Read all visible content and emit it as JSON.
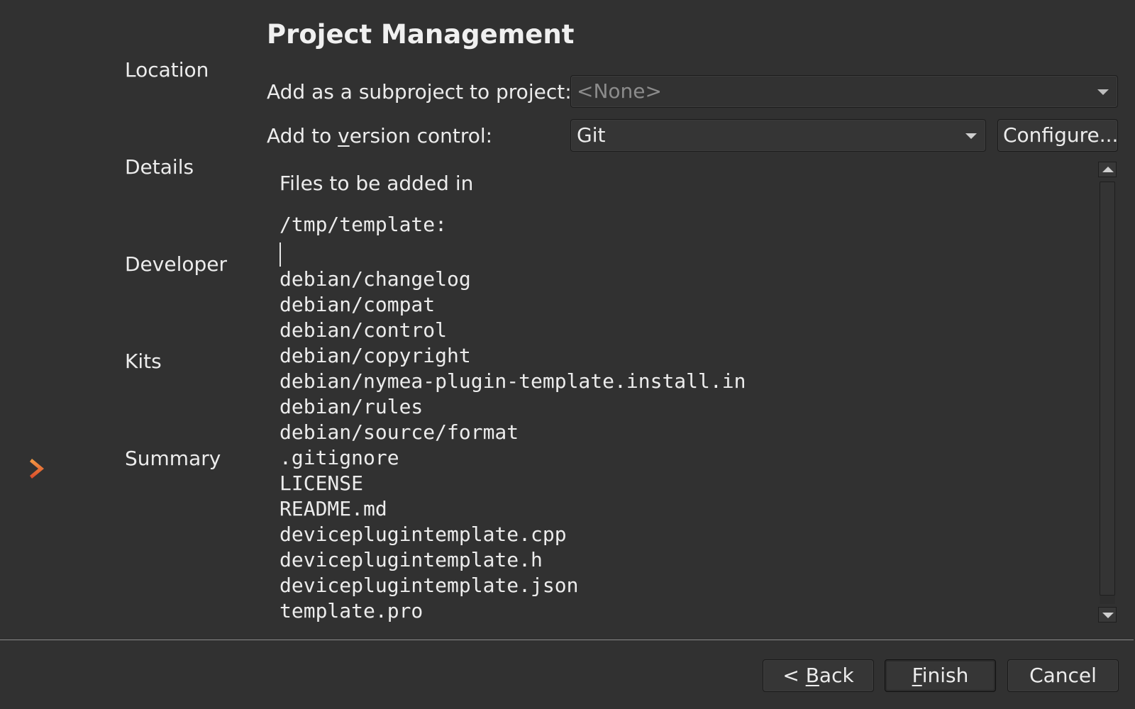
{
  "sidebar": {
    "items": [
      {
        "label": "Location",
        "current": false
      },
      {
        "label": "Details",
        "current": false
      },
      {
        "label": "Developer",
        "current": false
      },
      {
        "label": "Kits",
        "current": false
      },
      {
        "label": "Summary",
        "current": true
      }
    ]
  },
  "page": {
    "title": "Project Management"
  },
  "form": {
    "subproject_label": "Add as a subproject to project:",
    "subproject_value": "<None>",
    "vcs_label_pre": "Add to ",
    "vcs_label_mnemonic": "v",
    "vcs_label_post": "ersion control:",
    "vcs_value": "Git",
    "configure_label": "Configure..."
  },
  "files": {
    "intro": "Files to be added in",
    "path": "/tmp/template:",
    "list": [
      "debian/changelog",
      "debian/compat",
      "debian/control",
      "debian/copyright",
      "debian/nymea-plugin-template.install.in",
      "debian/rules",
      "debian/source/format",
      ".gitignore",
      "LICENSE",
      "README.md",
      "deviceplugintemplate.cpp",
      "deviceplugintemplate.h",
      "deviceplugintemplate.json",
      "template.pro"
    ],
    "scroll_position": 0.0,
    "visible_fraction": 0.98
  },
  "buttons": {
    "back_pre": "< ",
    "back_mnemonic": "B",
    "back_post": "ack",
    "finish_mnemonic": "F",
    "finish_post": "inish",
    "cancel": "Cancel"
  },
  "colors": {
    "background": "#313131",
    "text": "#ececec",
    "accent_arrow": "#e4572e"
  }
}
